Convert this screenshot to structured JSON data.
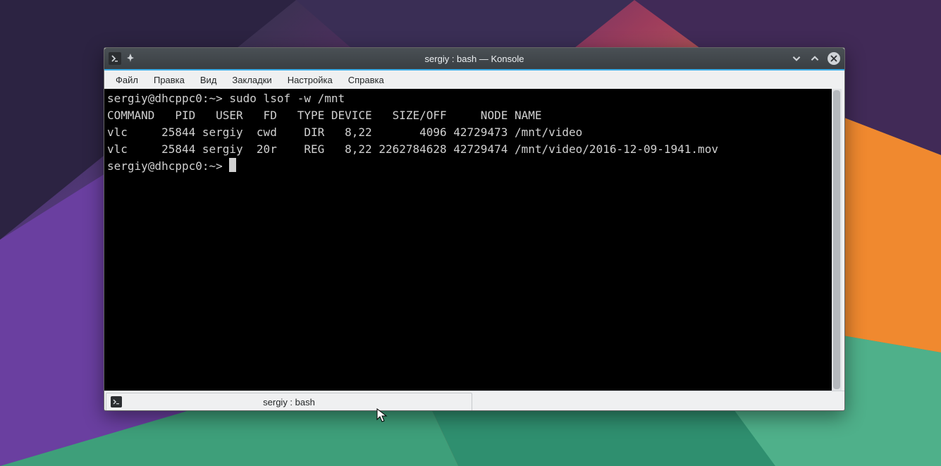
{
  "window": {
    "title": "sergiy : bash — Konsole"
  },
  "menubar": {
    "items": [
      "Файл",
      "Правка",
      "Вид",
      "Закладки",
      "Настройка",
      "Справка"
    ]
  },
  "terminal": {
    "prompt": "sergiy@dhcppc0:~> ",
    "command": "sudo lsof -w /mnt",
    "header": "COMMAND   PID   USER   FD   TYPE DEVICE   SIZE/OFF     NODE NAME",
    "rows": [
      "vlc     25844 sergiy  cwd    DIR   8,22       4096 42729473 /mnt/video",
      "vlc     25844 sergiy  20r    REG   8,22 2262784628 42729474 /mnt/video/2016-12-09-1941.mov"
    ],
    "prompt2": "sergiy@dhcppc0:~> "
  },
  "tab": {
    "label": "sergiy : bash"
  }
}
